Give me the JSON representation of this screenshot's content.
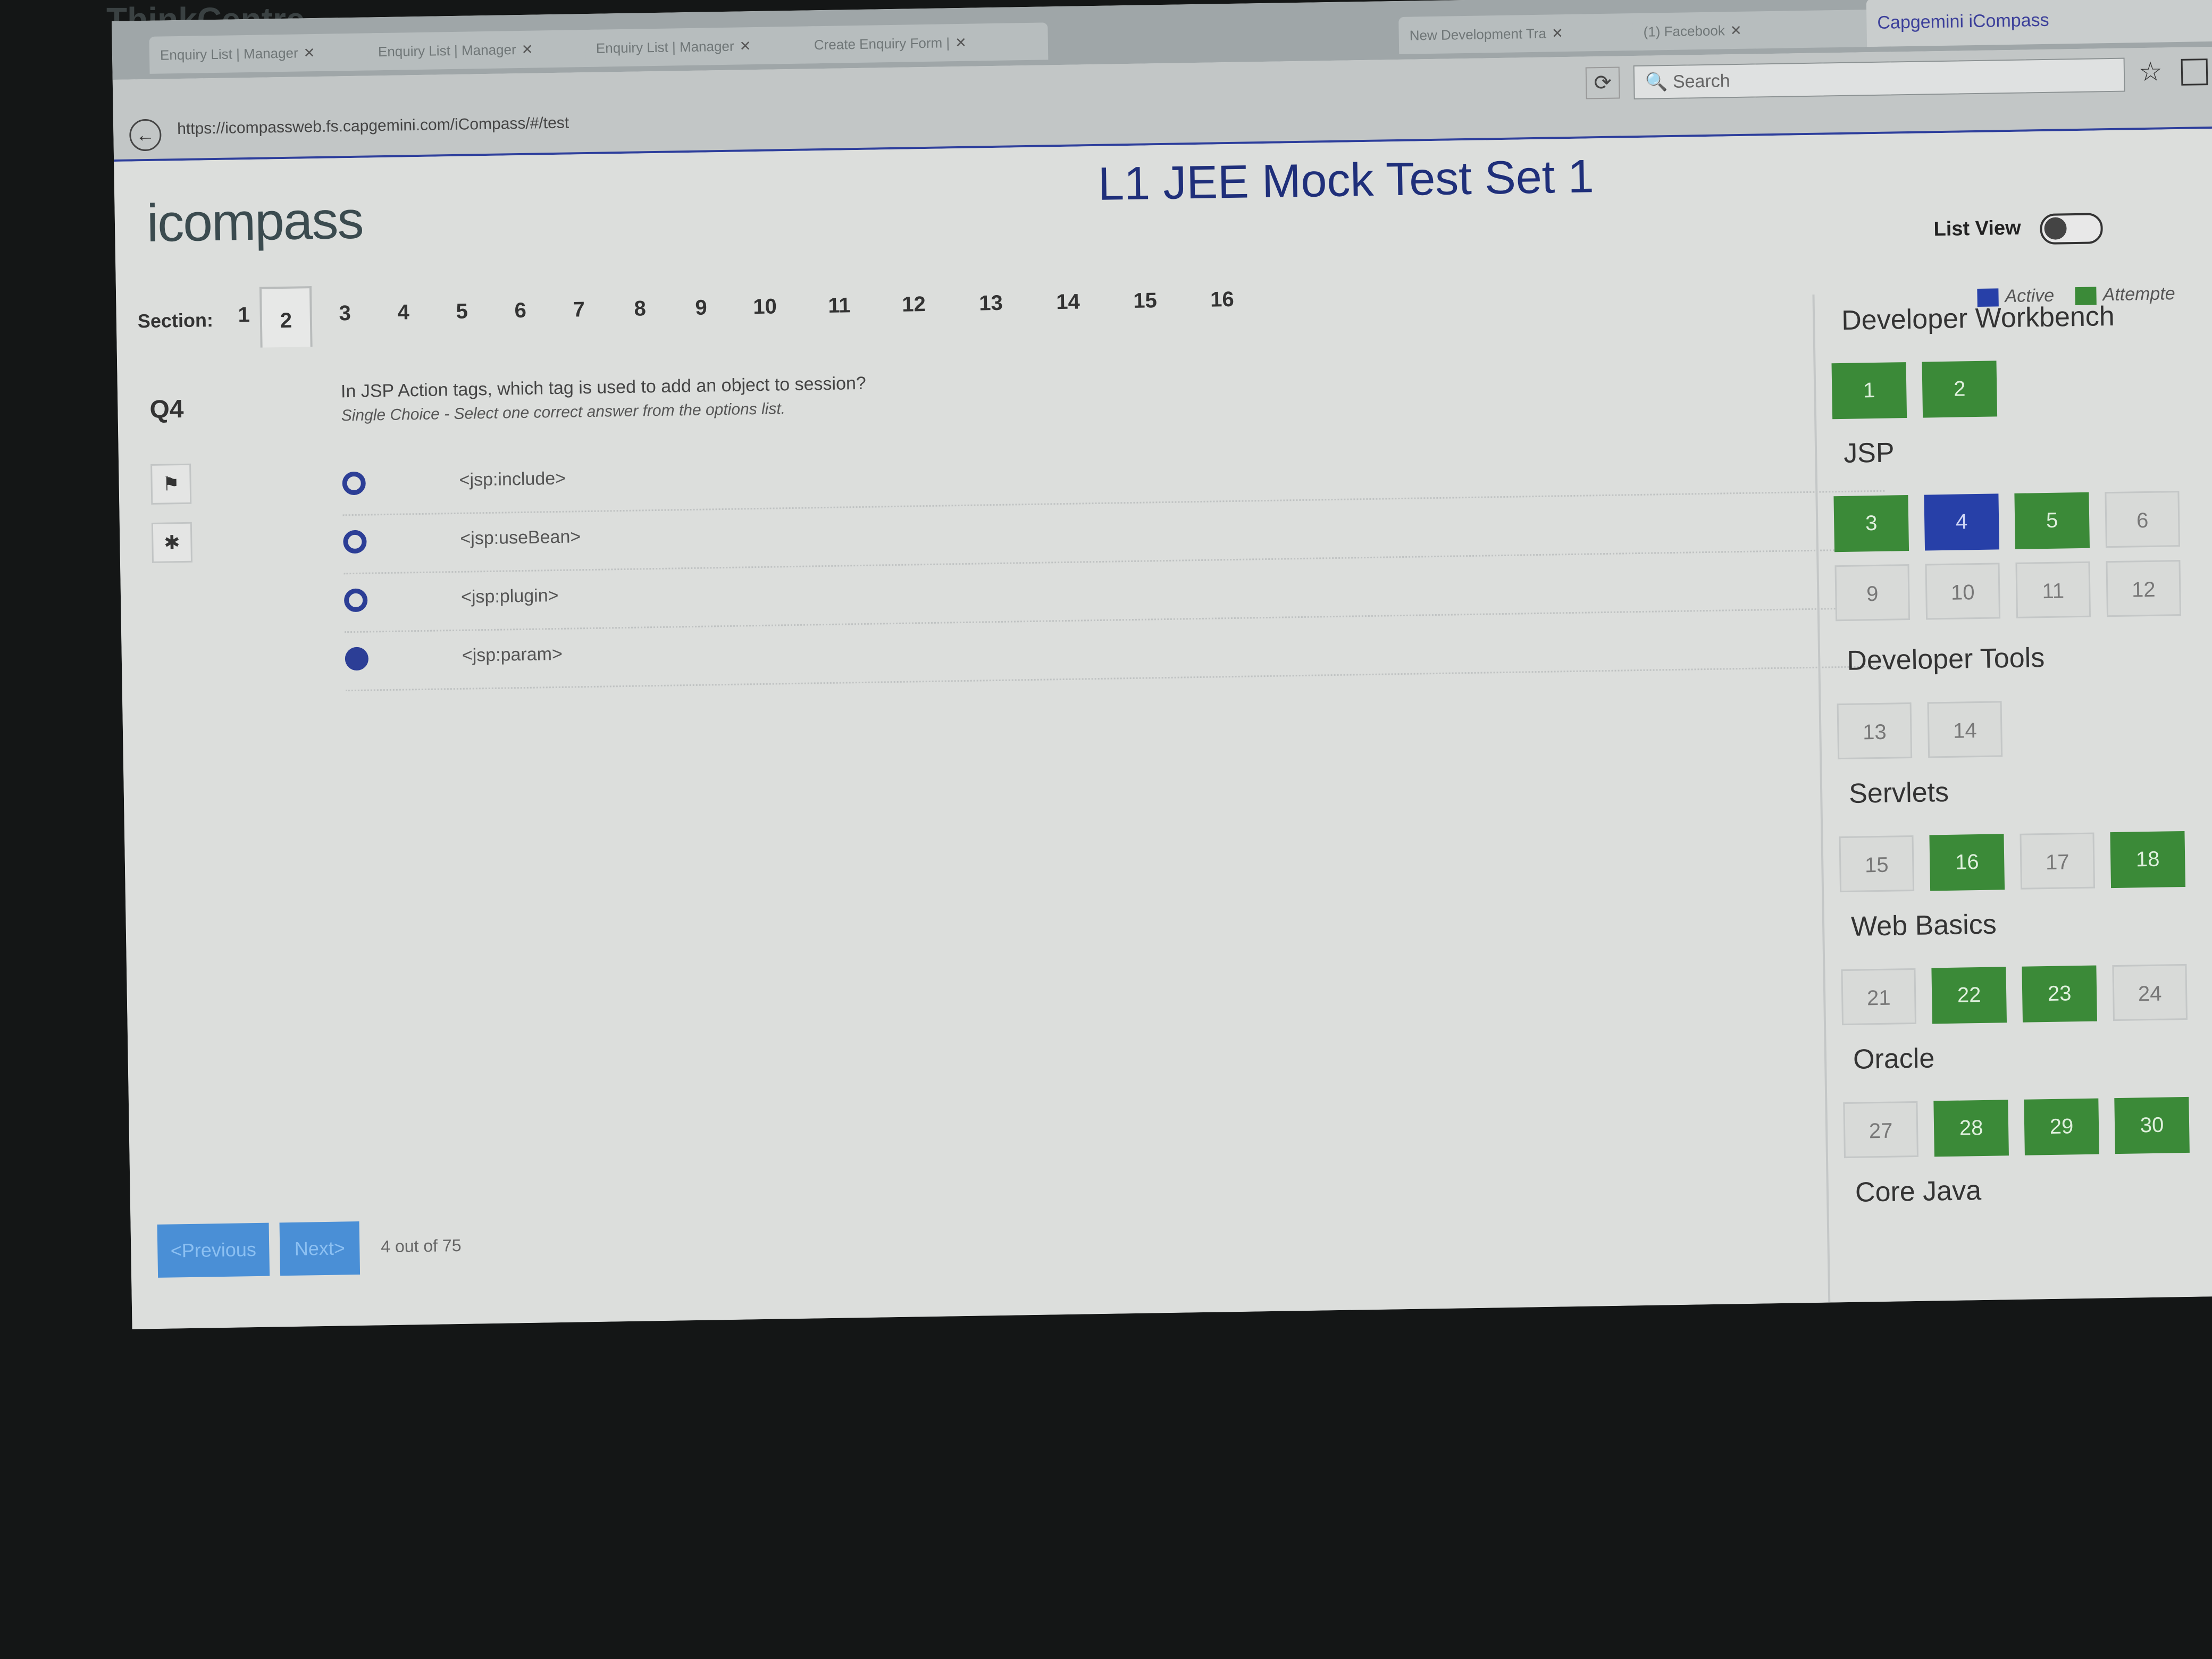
{
  "monitor_brand": "ThinkCentre",
  "browser": {
    "tabs": [
      {
        "label": "Enquiry List | Manager",
        "active": false
      },
      {
        "label": "Enquiry List | Manager",
        "active": false
      },
      {
        "label": "Enquiry List | Manager",
        "active": false
      },
      {
        "label": "Create Enquiry Form |",
        "active": false
      },
      {
        "label": "New Development Tra",
        "active": false
      },
      {
        "label": "(1) Facebook",
        "active": false
      },
      {
        "label": "Capgemini iCompass",
        "active": true
      }
    ],
    "url": "https://icompassweb.fs.capgemini.com/iCompass/#/test",
    "search_placeholder": "Search"
  },
  "app": {
    "logo": "icompass",
    "title": "L1 JEE Mock Test Set 1",
    "list_view_label": "List View",
    "legend": {
      "active": "Active",
      "attempted": "Attempte",
      "active_color": "#2740a8",
      "attempted_color": "#3b8a38"
    },
    "section_label": "Section:",
    "sections": [
      "1",
      "2",
      "3",
      "4",
      "5",
      "6",
      "7",
      "8",
      "9",
      "10",
      "11",
      "12",
      "13",
      "14",
      "15",
      "16"
    ],
    "current_section": "2"
  },
  "question": {
    "number": "Q4",
    "text": "In JSP Action tags, which tag is used to add an object to session?",
    "hint": "Single Choice - Select one correct answer from the options list.",
    "options": [
      {
        "label": "<jsp:include>",
        "selected": false
      },
      {
        "label": "<jsp:useBean>",
        "selected": false
      },
      {
        "label": "<jsp:plugin>",
        "selected": false
      },
      {
        "label": "<jsp:param>",
        "selected": true
      }
    ],
    "flag_icon": "flag-icon",
    "star_icon": "star-icon"
  },
  "footer": {
    "previous_label": "<Previous",
    "next_label": "Next>",
    "count": "4 out of 75"
  },
  "palette": {
    "categories": [
      {
        "name": "Developer Workbench",
        "tiles": [
          {
            "n": "1",
            "s": "attempted"
          },
          {
            "n": "2",
            "s": "attempted"
          }
        ]
      },
      {
        "name": "JSP",
        "tiles": [
          {
            "n": "3",
            "s": "attempted"
          },
          {
            "n": "4",
            "s": "active"
          },
          {
            "n": "5",
            "s": "attempted"
          },
          {
            "n": "6",
            "s": "unvisited"
          },
          {
            "n": "9",
            "s": "unvisited"
          },
          {
            "n": "10",
            "s": "unvisited"
          },
          {
            "n": "11",
            "s": "unvisited"
          },
          {
            "n": "12",
            "s": "unvisited"
          }
        ]
      },
      {
        "name": "Developer Tools",
        "tiles": [
          {
            "n": "13",
            "s": "unvisited"
          },
          {
            "n": "14",
            "s": "unvisited"
          }
        ]
      },
      {
        "name": "Servlets",
        "tiles": [
          {
            "n": "15",
            "s": "unvisited"
          },
          {
            "n": "16",
            "s": "attempted"
          },
          {
            "n": "17",
            "s": "unvisited"
          },
          {
            "n": "18",
            "s": "attempted"
          }
        ]
      },
      {
        "name": "Web Basics",
        "tiles": [
          {
            "n": "21",
            "s": "unvisited"
          },
          {
            "n": "22",
            "s": "attempted"
          },
          {
            "n": "23",
            "s": "attempted"
          },
          {
            "n": "24",
            "s": "unvisited"
          }
        ]
      },
      {
        "name": "Oracle",
        "tiles": [
          {
            "n": "27",
            "s": "unvisited"
          },
          {
            "n": "28",
            "s": "attempted"
          },
          {
            "n": "29",
            "s": "attempted"
          },
          {
            "n": "30",
            "s": "attempted"
          }
        ]
      },
      {
        "name": "Core Java",
        "tiles": []
      }
    ]
  },
  "taskbar": {
    "icons": [
      "start-icon",
      "ie-icon",
      "explorer-icon",
      "chrome-icon",
      "firefox-icon",
      "media-player-icon",
      "network-icon",
      "excel-icon"
    ]
  }
}
